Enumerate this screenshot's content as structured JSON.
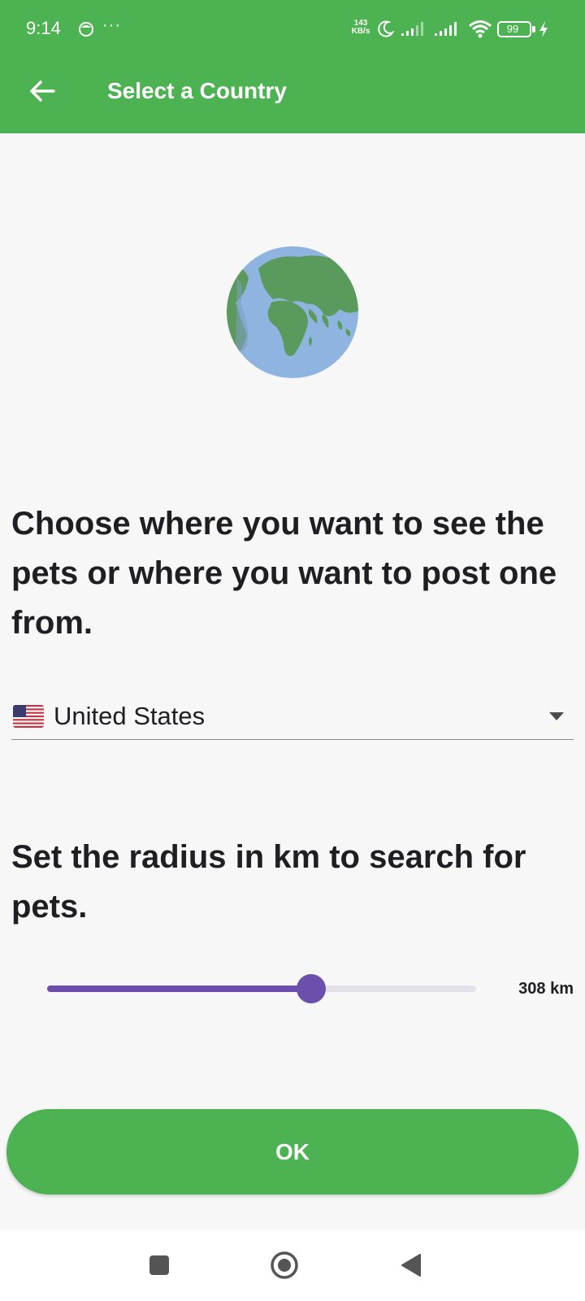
{
  "status_bar": {
    "time": "9:14",
    "dots": "···",
    "net_speed_value": "143",
    "net_speed_unit": "KB/s",
    "battery": "99"
  },
  "app_bar": {
    "title": "Select a Country",
    "back_icon": "arrow-left-icon"
  },
  "content": {
    "illustration_icon": "globe-icon",
    "country_prompt": "Choose where you want to see the pets or where you want to post one from.",
    "country_select": {
      "flag_icon": "us-flag-icon",
      "value": "United States",
      "arrow_icon": "dropdown-arrow-icon"
    },
    "radius_prompt": "Set the radius in km to search for pets.",
    "radius_slider": {
      "fraction": 0.615,
      "value_label": "308 km"
    },
    "ok_label": "OK"
  },
  "nav_bar": {
    "items": [
      "recents-square-icon",
      "home-circle-icon",
      "back-triangle-icon"
    ]
  },
  "colors": {
    "primary_green": "#4db251",
    "slider_purple": "#6b4fab",
    "slider_inactive": "#e4e1ea",
    "background": "#f7f7f8"
  }
}
